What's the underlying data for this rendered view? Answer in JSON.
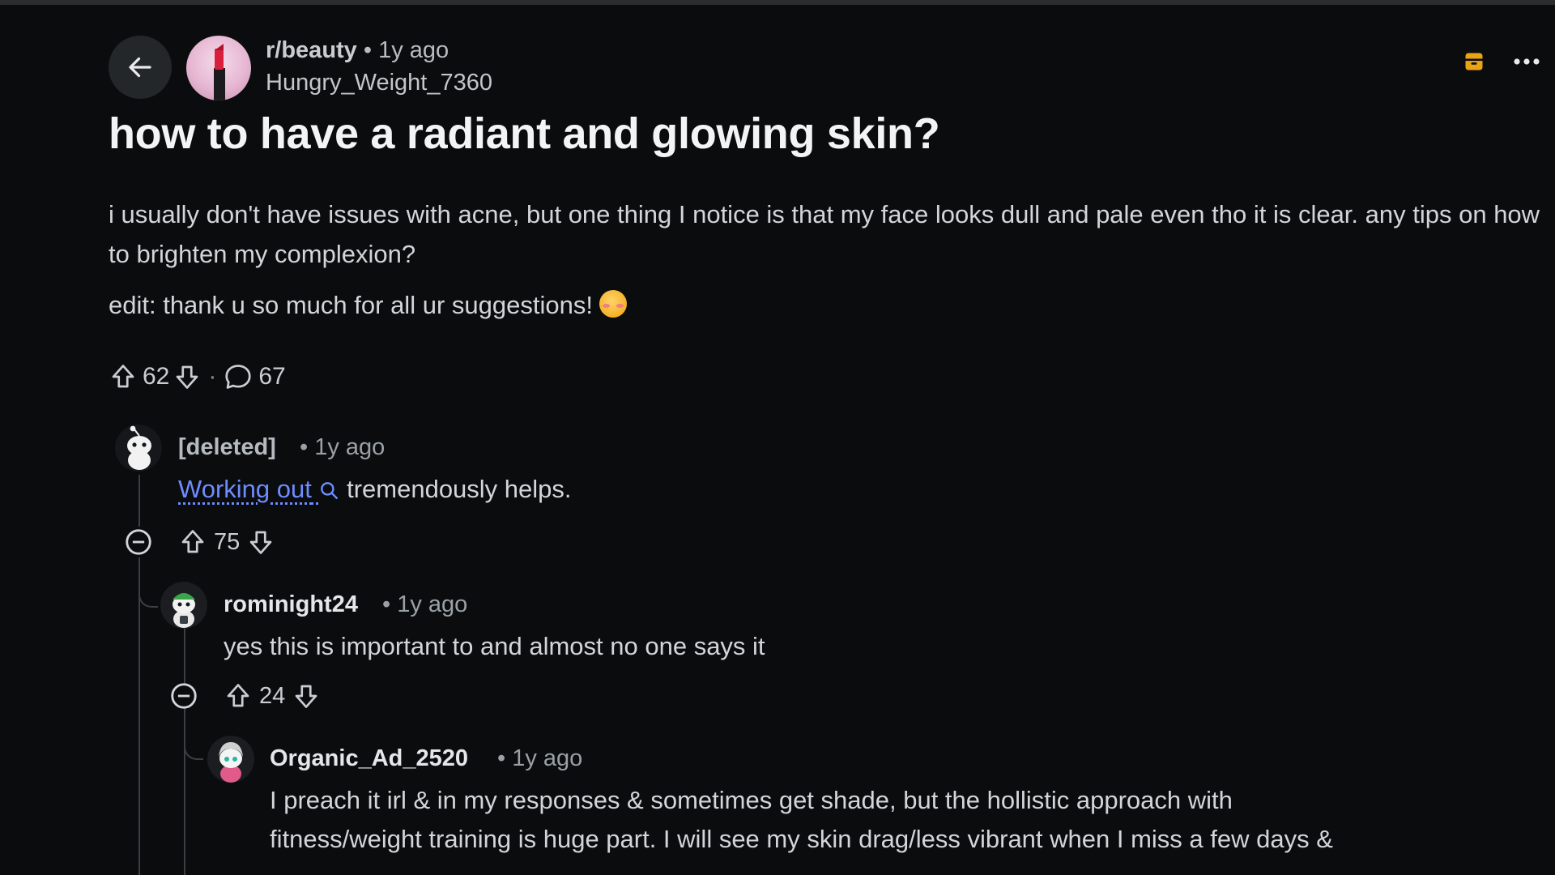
{
  "header": {
    "subreddit": "r/beauty",
    "time": "• 1y ago",
    "author": "Hungry_Weight_7360"
  },
  "post": {
    "title": "how to have a radiant and glowing skin?",
    "body": "i usually don't have issues with acne, but one thing I notice is that my face looks dull and pale even tho it is clear. any tips on how to brighten my complexion?",
    "edit": "edit: thank u so much for all ur suggestions!",
    "votes": "62",
    "separator": "·",
    "comments_count": "67"
  },
  "comments": [
    {
      "author": "[deleted]",
      "time": "• 1y ago",
      "link_text": "Working out",
      "text": "tremendously helps.",
      "votes": "75"
    },
    {
      "author": "rominight24",
      "time": "• 1y ago",
      "text": "yes this is important to and almost no one says it",
      "votes": "24"
    },
    {
      "author": "Organic_Ad_2520",
      "time": "• 1y ago",
      "text_line1": "I preach it irl & in my responses & sometimes get shade, but the hollistic approach with",
      "text_line2": "fitness/weight training is huge part. I will see my skin drag/less vibrant when I miss a few days &"
    }
  ],
  "colors": {
    "background": "#0b0c0d",
    "link": "#6f8cff",
    "award": "#e8a317"
  },
  "icons": [
    "back-arrow-icon",
    "subreddit-avatar",
    "award-icon",
    "more-options-icon",
    "upvote-icon",
    "downvote-icon",
    "comment-icon",
    "search-icon",
    "collapse-icon"
  ]
}
